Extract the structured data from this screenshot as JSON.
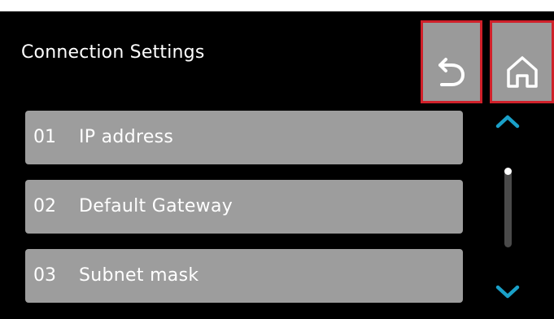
{
  "header": {
    "title": "Connection Settings"
  },
  "nav": {
    "back_icon": "back-arrow-icon",
    "home_icon": "home-icon",
    "highlight_color": "#d0202a",
    "button_color": "#9a9a9a"
  },
  "list": {
    "items": [
      {
        "number": "01",
        "label": "IP address"
      },
      {
        "number": "02",
        "label": "Default Gateway"
      },
      {
        "number": "03",
        "label": "Subnet mask"
      }
    ],
    "item_color": "#9d9d9d"
  },
  "scroll": {
    "up_icon": "chevron-up-icon",
    "down_icon": "chevron-down-icon",
    "accent_color": "#1aa0c8",
    "position": 0
  }
}
